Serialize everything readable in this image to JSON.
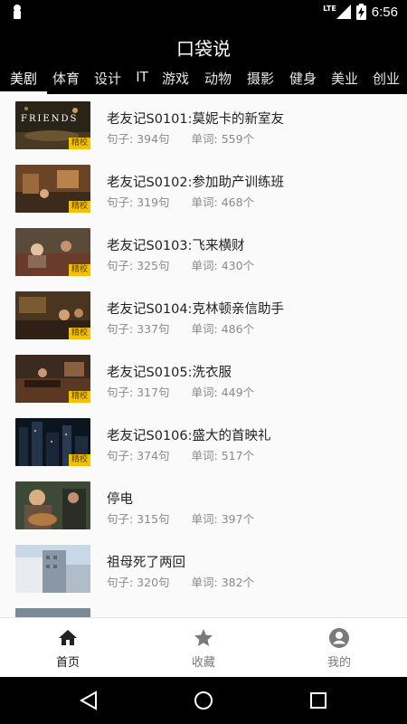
{
  "status": {
    "network": "LTE",
    "time": "6:56"
  },
  "app": {
    "title": "口袋说"
  },
  "tabs": [
    "美剧",
    "体育",
    "设计",
    "IT",
    "游戏",
    "动物",
    "摄影",
    "健身",
    "美业",
    "创业"
  ],
  "active_tab": 0,
  "items": [
    {
      "title": "老友记S0101:莫妮卡的新室友",
      "sentences": "句子: 394句",
      "words": "单词: 559个",
      "badge": "精校",
      "thumb_text": "FRIENDS"
    },
    {
      "title": "老友记S0102:参加助产训练班",
      "sentences": "句子: 319句",
      "words": "单词: 468个",
      "badge": "精校"
    },
    {
      "title": "老友记S0103:飞来横财",
      "sentences": "句子: 325句",
      "words": "单词: 430个",
      "badge": "精校"
    },
    {
      "title": "老友记S0104:克林顿亲信助手",
      "sentences": "句子: 337句",
      "words": "单词: 486个",
      "badge": "精校"
    },
    {
      "title": "老友记S0105:洗衣服",
      "sentences": "句子: 317句",
      "words": "单词: 449个",
      "badge": "精校"
    },
    {
      "title": "老友记S0106:盛大的首映礼",
      "sentences": "句子: 374句",
      "words": "单词: 517个",
      "badge": "精校"
    },
    {
      "title": "停电",
      "sentences": "句子: 315句",
      "words": "单词: 397个",
      "badge": ""
    },
    {
      "title": "祖母死了两回",
      "sentences": "句子: 320句",
      "words": "单词: 382个",
      "badge": ""
    }
  ],
  "bottom_nav": [
    {
      "label": "首页",
      "icon": "home-icon"
    },
    {
      "label": "收藏",
      "icon": "star-icon"
    },
    {
      "label": "我的",
      "icon": "account-icon"
    }
  ],
  "colors": {
    "badge": "#f2c200",
    "appbar": "#000000",
    "list_bg": "#fafafa"
  }
}
